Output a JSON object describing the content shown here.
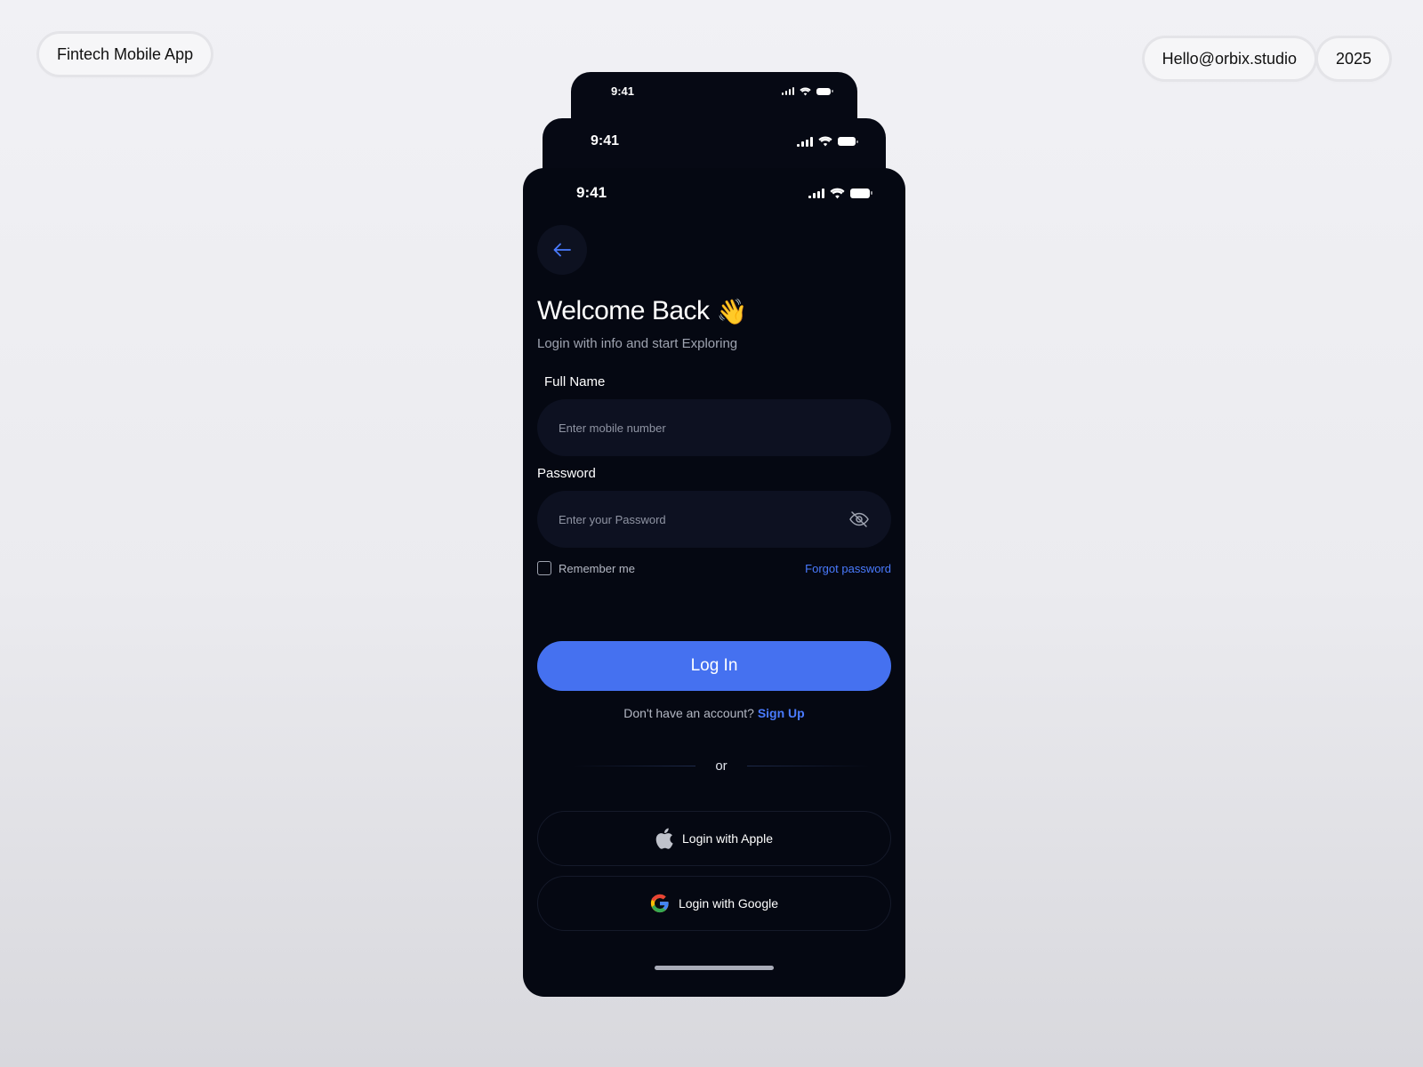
{
  "header": {
    "project_label": "Fintech Mobile App",
    "email": "Hello@orbix.studio",
    "year": "2025"
  },
  "status_bar": {
    "time": "9:41"
  },
  "screen": {
    "title": "Welcome Back",
    "title_emoji": "👋",
    "subtitle": "Login with info and start Exploring",
    "full_name": {
      "label": "Full Name",
      "placeholder": "Enter mobile number"
    },
    "password": {
      "label": "Password",
      "placeholder": "Enter your Password"
    },
    "remember_label": "Remember me",
    "forgot_label": "Forgot password",
    "login_label": "Log In",
    "signup_prompt": "Don't have an account?",
    "signup_link": "Sign Up",
    "or_label": "or",
    "apple_label": "Login with Apple",
    "google_label": "Login with Google"
  },
  "colors": {
    "accent": "#4571f0",
    "link": "#4a7bff",
    "screen_bg": "#050812",
    "input_bg": "#0d1121"
  },
  "icons": [
    "signal-icon",
    "wifi-icon",
    "battery-icon",
    "back-arrow-icon",
    "eye-off-icon",
    "apple-icon",
    "google-icon"
  ]
}
